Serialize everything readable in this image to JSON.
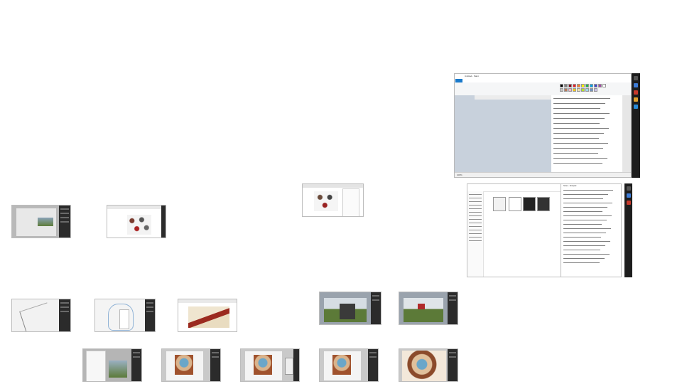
{
  "slide": {
    "background": "#ffffff"
  },
  "paint_window": {
    "title": "Untitled - Paint",
    "status_left": "100%",
    "status_right": "1366 × 768px",
    "file_tab_color": "#1979ca",
    "palette_colors": [
      "#000000",
      "#7f7f7f",
      "#880015",
      "#ed1c24",
      "#ff7f27",
      "#fff200",
      "#22b14c",
      "#00a2e8",
      "#3f48cc",
      "#a349a4",
      "#ffffff",
      "#c3c3c3",
      "#b97a57",
      "#ffaec9",
      "#ffc90e",
      "#efe4b0",
      "#b5e61d",
      "#99d9ea",
      "#7092be",
      "#c8bfe7"
    ],
    "thumbnail_labels": [
      "Slide1",
      "Slide2",
      "Slide3",
      "Slide4"
    ]
  },
  "explorer_window": {
    "title": "Notes - Notepad",
    "file_names": [
      "Notes",
      "Untitled",
      "Untitled",
      "Untitled"
    ]
  },
  "thumbnails": [
    {
      "name": "slide-thumb-1",
      "kind": "editor"
    },
    {
      "name": "slide-thumb-2",
      "kind": "browser"
    },
    {
      "name": "slide-thumb-3",
      "kind": "browser"
    },
    {
      "name": "slide-thumb-4",
      "kind": "sketch"
    },
    {
      "name": "slide-thumb-5",
      "kind": "sketch"
    },
    {
      "name": "slide-thumb-6",
      "kind": "browser"
    },
    {
      "name": "slide-thumb-7",
      "kind": "scene"
    },
    {
      "name": "slide-thumb-8",
      "kind": "scene"
    },
    {
      "name": "slide-thumb-9",
      "kind": "menu"
    },
    {
      "name": "slide-thumb-10",
      "kind": "figure"
    },
    {
      "name": "slide-thumb-11",
      "kind": "figure"
    },
    {
      "name": "slide-thumb-12",
      "kind": "figure"
    },
    {
      "name": "slide-thumb-13",
      "kind": "figure"
    }
  ]
}
